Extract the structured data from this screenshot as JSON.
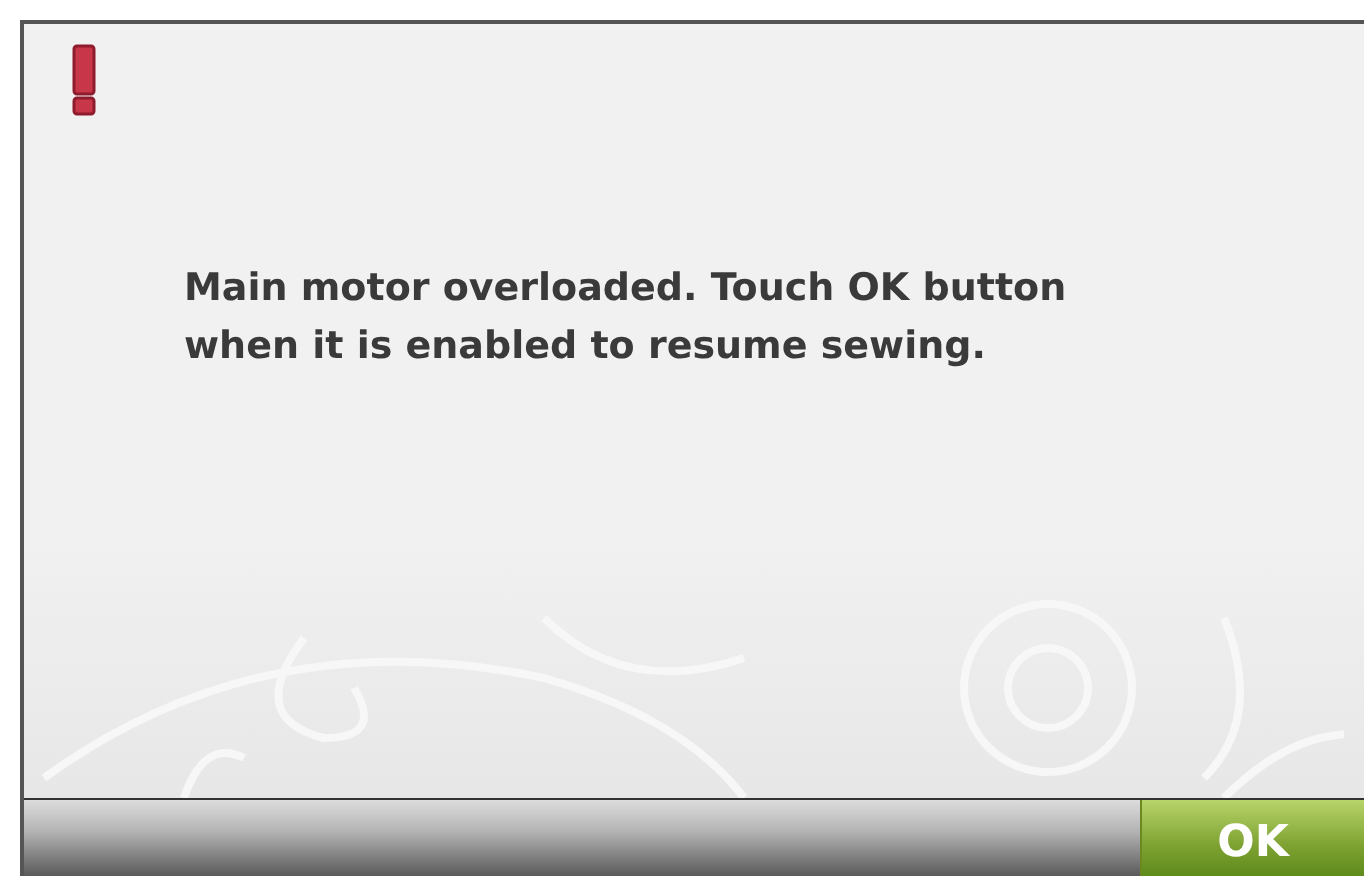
{
  "alert": {
    "message": "Main motor overloaded. Touch OK button when it is enabled to resume sewing."
  },
  "ok_button": {
    "label": "OK",
    "enabled": true
  }
}
